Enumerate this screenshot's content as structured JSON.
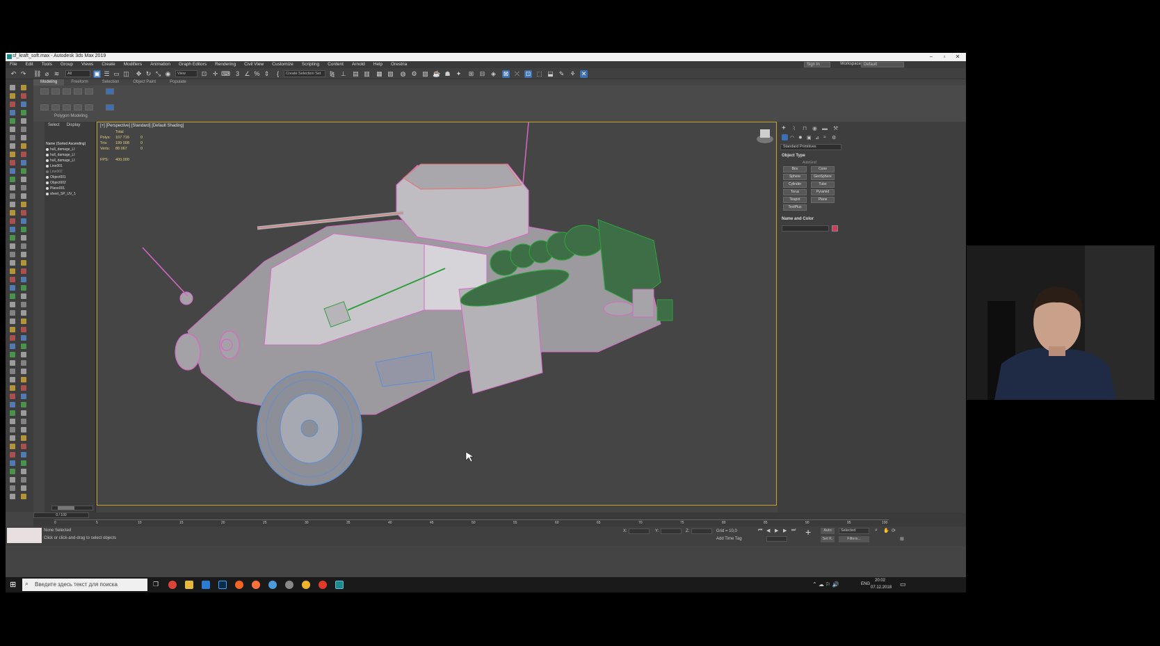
{
  "window": {
    "title": "sf_kraft_soft.max - Autodesk 3ds Max 2019",
    "min": "–",
    "max": "▫",
    "close": "✕"
  },
  "menu": [
    "File",
    "Edit",
    "Tools",
    "Group",
    "Views",
    "Create",
    "Modifiers",
    "Animation",
    "Graph Editors",
    "Rendering",
    "Civil View",
    "Customize",
    "Scripting",
    "Content",
    "Arnold",
    "Help",
    "Orestria"
  ],
  "menu_right": {
    "signin": "Sign In",
    "workspaces_label": "Workspaces:",
    "workspace": "Default"
  },
  "toolbar": {
    "selection_filter": "All",
    "view": "View",
    "selection_set": "Create Selection Set"
  },
  "ribbon": {
    "tabs": [
      "Modeling",
      "Freeform",
      "Selection",
      "Object Paint",
      "Populate"
    ],
    "panel": "Polygon Modeling"
  },
  "scene_explorer": {
    "tabs": [
      "Select",
      "Display"
    ],
    "header": "Name (Sorted Ascending)",
    "items": [
      "hull_damage_LI",
      "hull_damage_LI",
      "hull_damage_LI",
      "Line001",
      "Line002",
      "Object001",
      "Object002",
      "Plane001",
      "sheet_SP_UV_1"
    ]
  },
  "viewport": {
    "label": "[+] [Perspective] [Standard] [Default Shading]",
    "stats": {
      "header": "Total",
      "polys_label": "Polys:",
      "polys": "107 716",
      "tris_label": "Tris:",
      "tris": "199 008",
      "verts_label": "Verts:",
      "verts": "88 067",
      "fps_label": "FPS:",
      "fps": "400,000"
    }
  },
  "command_panel": {
    "dropdown": "Standard Primitives",
    "object_type": "Object Type",
    "autogrid": "AutoGrid",
    "buttons": [
      "Box",
      "Cone",
      "Sphere",
      "GeoSphere",
      "Cylinder",
      "Tube",
      "Torus",
      "Pyramid",
      "Teapot",
      "Plane",
      "TextPlus"
    ],
    "name_color": "Name and Color",
    "swatch_color": "#d23c5a"
  },
  "timeline": {
    "frame": "0 / 100",
    "ticks": [
      "0",
      "5",
      "10",
      "15",
      "20",
      "25",
      "30",
      "35",
      "40",
      "45",
      "50",
      "55",
      "60",
      "65",
      "70",
      "75",
      "80",
      "85",
      "90",
      "95",
      "100"
    ]
  },
  "status": {
    "none_selected": "None Selected",
    "prompt": "Click or click-and-drag to select objects",
    "x_label": "X:",
    "y_label": "Y:",
    "z_label": "Z:",
    "grid": "Grid = 10,0",
    "add_time_tag": "Add Time Tag",
    "auto": "Auto",
    "set_key": "Set K.",
    "selected": "Selected",
    "filters": "Filters..."
  },
  "taskbar": {
    "search_placeholder": "Введите здесь текст для поиска",
    "lang": "ENG",
    "time": "20:02",
    "date": "07.12.2018"
  },
  "colors": {
    "accent": "#3c6fb3",
    "viewport_border": "#c9a227",
    "wire_pink": "#d768c8",
    "wire_green": "#2f9e3e",
    "wire_blue": "#5b8fd8"
  }
}
